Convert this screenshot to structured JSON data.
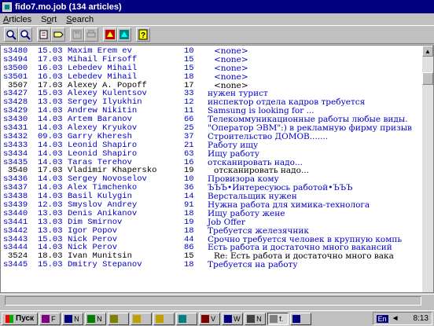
{
  "window": {
    "title": "fido7.mo.job (134 articles)"
  },
  "menu": [
    {
      "pre": "",
      "u": "A",
      "post": "rticles"
    },
    {
      "pre": "S",
      "u": "o",
      "post": "rt"
    },
    {
      "pre": "",
      "u": "S",
      "post": "earch"
    }
  ],
  "toolbar": {
    "buttons": [
      "zoom-in-icon",
      "zoom-out-icon",
      "edit-icon",
      "tag-icon",
      "save-disabled-icon",
      "print-disabled-icon",
      "mark-red-icon",
      "mark-teal-icon",
      "help-icon"
    ]
  },
  "articles": [
    {
      "flag": "s",
      "num": "3480",
      "date": "15.03",
      "from": "Maxim Erem ev",
      "lines": "10",
      "subject": "<none>",
      "read": false,
      "indent": 1
    },
    {
      "flag": "s",
      "num": "3494",
      "date": "17.03",
      "from": "Mihail Firsoff",
      "lines": "15",
      "subject": "<none>",
      "read": false,
      "indent": 1
    },
    {
      "flag": "s",
      "num": "3500",
      "date": "16.03",
      "from": "Lebedev Mihail",
      "lines": "15",
      "subject": "<none>",
      "read": false,
      "indent": 1
    },
    {
      "flag": "s",
      "num": "3501",
      "date": "16.03",
      "from": "Lebedev Mihail",
      "lines": "18",
      "subject": "<none>",
      "read": false,
      "indent": 1
    },
    {
      "flag": "",
      "num": "3507",
      "date": "17.03",
      "from": "Alexey A. Popoff",
      "lines": "17",
      "subject": "<none>",
      "read": true,
      "indent": 1
    },
    {
      "flag": "s",
      "num": "3427",
      "date": "15.03",
      "from": "Alexey Kulentsov",
      "lines": "33",
      "subject": "нужен турист",
      "read": false,
      "indent": 0
    },
    {
      "flag": "s",
      "num": "3428",
      "date": "13.03",
      "from": "Sergey Ilyukhin",
      "lines": "12",
      "subject": "инспектор отдела кадров требуется",
      "read": false,
      "indent": 0
    },
    {
      "flag": "s",
      "num": "3429",
      "date": "14.03",
      "from": "Andrew Nikitin",
      "lines": "11",
      "subject": "Samsung is looking for ...",
      "read": false,
      "indent": 0
    },
    {
      "flag": "s",
      "num": "3430",
      "date": "14.03",
      "from": "Artem Baranov",
      "lines": "66",
      "subject": "Телекоммуникационные работы любые виды.",
      "read": false,
      "indent": 0
    },
    {
      "flag": "s",
      "num": "3431",
      "date": "14.03",
      "from": "Alexey Kryukov",
      "lines": "25",
      "subject": "\"Оператор ЭВМ\":) в рекламную фирму призыв",
      "read": false,
      "indent": 0
    },
    {
      "flag": "s",
      "num": "3432",
      "date": "09.03",
      "from": "Garry Kheresh",
      "lines": "37",
      "subject": "Строительство ДОМОВ.......",
      "read": false,
      "indent": 0
    },
    {
      "flag": "s",
      "num": "3433",
      "date": "14.03",
      "from": "Leonid Shapiro",
      "lines": "21",
      "subject": "Работу ищу",
      "read": false,
      "indent": 0
    },
    {
      "flag": "s",
      "num": "3434",
      "date": "14.03",
      "from": "Leonid Shapiro",
      "lines": "63",
      "subject": "Ищу работу",
      "read": false,
      "indent": 0
    },
    {
      "flag": "s",
      "num": "3435",
      "date": "14.03",
      "from": "Taras Terehov",
      "lines": "16",
      "subject": "отсканировать надо...",
      "read": false,
      "indent": 0
    },
    {
      "flag": "",
      "num": "3540",
      "date": "17.03",
      "from": "Vladimir Khapersko",
      "lines": "19",
      "subject": "отсканировать надо...",
      "read": true,
      "indent": 1
    },
    {
      "flag": "s",
      "num": "3436",
      "date": "14.03",
      "from": "Sergey Novoselov",
      "lines": "10",
      "subject": "Провизора кому",
      "read": false,
      "indent": 0
    },
    {
      "flag": "s",
      "num": "3437",
      "date": "14.03",
      "from": "Alex Timchenko",
      "lines": "36",
      "subject": "ЪЪЪ•Интересуюсь работой•ЪЪЪ",
      "read": false,
      "indent": 0
    },
    {
      "flag": "s",
      "num": "3438",
      "date": "14.03",
      "from": "Basil Kulygin",
      "lines": "14",
      "subject": "Верстальщик нужен",
      "read": false,
      "indent": 0
    },
    {
      "flag": "s",
      "num": "3439",
      "date": "12.03",
      "from": "Smyslov Andrey",
      "lines": "91",
      "subject": "Нужна работа для химика-технолога",
      "read": false,
      "indent": 0
    },
    {
      "flag": "s",
      "num": "3440",
      "date": "13.03",
      "from": "Denis Anikanov",
      "lines": "18",
      "subject": "Ищу работу жене",
      "read": false,
      "indent": 0
    },
    {
      "flag": "s",
      "num": "3441",
      "date": "13.03",
      "from": "Dim Smirnov",
      "lines": "19",
      "subject": "Job Offer",
      "read": false,
      "indent": 0
    },
    {
      "flag": "s",
      "num": "3442",
      "date": "13.03",
      "from": "Igor Popov",
      "lines": "18",
      "subject": "Требуется железячник",
      "read": false,
      "indent": 0
    },
    {
      "flag": "s",
      "num": "3443",
      "date": "15.03",
      "from": "Nick Perov",
      "lines": "44",
      "subject": "Срочно требуется человек в крупную компь",
      "read": false,
      "indent": 0
    },
    {
      "flag": "s",
      "num": "3444",
      "date": "14.03",
      "from": "Nick Perov",
      "lines": "86",
      "subject": "Есть работа и достаточно много вакансий",
      "read": false,
      "indent": 0
    },
    {
      "flag": "",
      "num": "3524",
      "date": "18.03",
      "from": "Ivan Munitsin",
      "lines": "15",
      "subject": "Re: Есть работа и достаточно много вака",
      "read": true,
      "indent": 1
    },
    {
      "flag": "s",
      "num": "3445",
      "date": "15.03",
      "from": "Dmitry Stepanov",
      "lines": "18",
      "subject": "Требуется на работу",
      "read": false,
      "indent": 0
    }
  ],
  "taskbar": {
    "start_label": "Пуск",
    "tasks": [
      "F",
      "N",
      "N",
      "",
      "",
      "",
      "",
      "V",
      "W",
      "N",
      "f.",
      ""
    ],
    "lang": "En",
    "clock": "8:13"
  }
}
